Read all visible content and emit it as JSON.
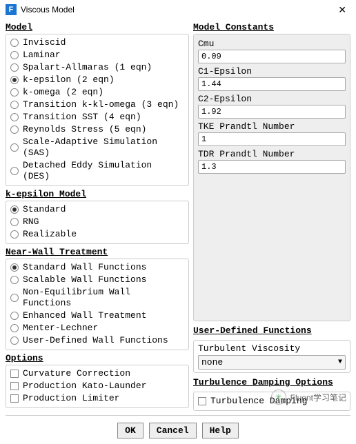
{
  "title": "Viscous Model",
  "groups": {
    "model": {
      "title": "Model",
      "items": [
        {
          "label": "Inviscid",
          "selected": false
        },
        {
          "label": "Laminar",
          "selected": false
        },
        {
          "label": "Spalart-Allmaras (1 eqn)",
          "selected": false
        },
        {
          "label": "k-epsilon (2 eqn)",
          "selected": true
        },
        {
          "label": "k-omega (2 eqn)",
          "selected": false
        },
        {
          "label": "Transition k-kl-omega (3 eqn)",
          "selected": false
        },
        {
          "label": "Transition SST (4 eqn)",
          "selected": false
        },
        {
          "label": "Reynolds Stress (5 eqn)",
          "selected": false
        },
        {
          "label": "Scale-Adaptive Simulation (SAS)",
          "selected": false
        },
        {
          "label": "Detached Eddy Simulation (DES)",
          "selected": false
        }
      ]
    },
    "kepsilon": {
      "title": "k-epsilon Model",
      "items": [
        {
          "label": "Standard",
          "selected": true
        },
        {
          "label": "RNG",
          "selected": false
        },
        {
          "label": "Realizable",
          "selected": false
        }
      ]
    },
    "nearwall": {
      "title": "Near-Wall Treatment",
      "items": [
        {
          "label": "Standard Wall Functions",
          "selected": true
        },
        {
          "label": "Scalable Wall Functions",
          "selected": false
        },
        {
          "label": "Non-Equilibrium Wall Functions",
          "selected": false
        },
        {
          "label": "Enhanced Wall Treatment",
          "selected": false
        },
        {
          "label": "Menter-Lechner",
          "selected": false
        },
        {
          "label": "User-Defined Wall Functions",
          "selected": false
        }
      ]
    },
    "options": {
      "title": "Options",
      "items": [
        {
          "label": "Curvature Correction"
        },
        {
          "label": "Production Kato-Launder"
        },
        {
          "label": "Production Limiter"
        }
      ]
    }
  },
  "constants": {
    "title": "Model Constants",
    "items": [
      {
        "label": "Cmu",
        "value": "0.09"
      },
      {
        "label": "C1-Epsilon",
        "value": "1.44"
      },
      {
        "label": "C2-Epsilon",
        "value": "1.92"
      },
      {
        "label": "TKE Prandtl Number",
        "value": "1"
      },
      {
        "label": "TDR Prandtl Number",
        "value": "1.3"
      }
    ]
  },
  "udf": {
    "title": "User-Defined Functions",
    "label": "Turbulent Viscosity",
    "value": "none"
  },
  "damping": {
    "title": "Turbulence Damping Options",
    "label": "Turbulence Damping"
  },
  "buttons": {
    "ok": "OK",
    "cancel": "Cancel",
    "help": "Help"
  },
  "watermark": "Fluent学习笔记"
}
